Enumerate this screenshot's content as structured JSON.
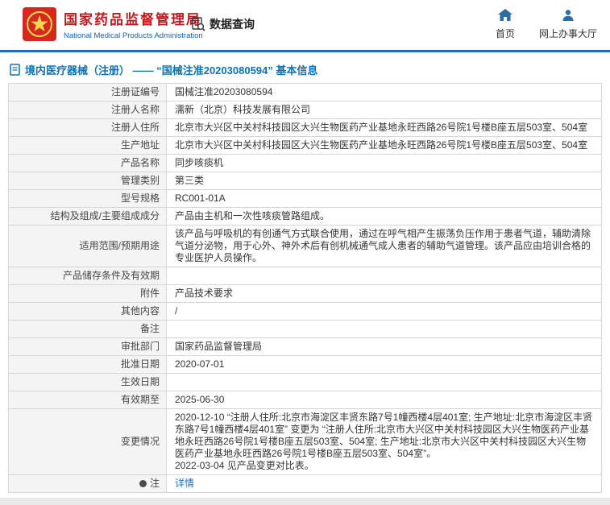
{
  "header": {
    "org_name_cn": "国家药品监督管理局",
    "org_name_en": "National Medical Products Administration",
    "data_query_label": "数据查询",
    "nav": [
      {
        "label": "首页",
        "icon": "home-icon"
      },
      {
        "label": "网上办事大厅",
        "icon": "person-icon"
      }
    ]
  },
  "page": {
    "title": "境内医疗器械（注册） —— “国械注准20203080594” 基本信息"
  },
  "colors": {
    "brand_red": "#c01920",
    "brand_blue": "#1b62a7",
    "header_line_blue": "#1e6cb5",
    "title_blue": "#0c72b8",
    "link_blue": "#1a73c0",
    "label_cell_bg": "#f4f4f4",
    "border": "#d6d6d6"
  },
  "icons": {
    "emblem": "national-emblem-icon",
    "data_query": "document-magnifier-icon",
    "home": "home-icon",
    "service_hall": "person-icon",
    "title": "document-icon",
    "note": "note-dot-icon"
  },
  "table": {
    "rows": [
      {
        "label": "注册证编号",
        "value": "国械注准20203080594"
      },
      {
        "label": "注册人名称",
        "value": "濡新（北京）科技发展有限公司"
      },
      {
        "label": "注册人住所",
        "value": "北京市大兴区中关村科技园区大兴生物医药产业基地永旺西路26号院1号楼B座五层503室、504室"
      },
      {
        "label": "生产地址",
        "value": "北京市大兴区中关村科技园区大兴生物医药产业基地永旺西路26号院1号楼B座五层503室、504室"
      },
      {
        "label": "产品名称",
        "value": "同步咳痰机"
      },
      {
        "label": "管理类别",
        "value": "第三类"
      },
      {
        "label": "型号规格",
        "value": "RC001-01A"
      },
      {
        "label": "结构及组成/主要组成成分",
        "value": "产品由主机和一次性咳痰管路组成。"
      },
      {
        "label": "适用范围/预期用途",
        "value": "该产品与呼吸机的有创通气方式联合使用，通过在呼气相产生振荡负压作用于患者气道，辅助清除气道分泌物，用于心外、神外术后有创机械通气成人患者的辅助气道管理。该产品应由培训合格的专业医护人员操作。"
      },
      {
        "label": "产品储存条件及有效期",
        "value": ""
      },
      {
        "label": "附件",
        "value": "产品技术要求"
      },
      {
        "label": "其他内容",
        "value": "/"
      },
      {
        "label": "备注",
        "value": ""
      },
      {
        "label": "审批部门",
        "value": "国家药品监督管理局"
      },
      {
        "label": "批准日期",
        "value": "2020-07-01"
      },
      {
        "label": "生效日期",
        "value": ""
      },
      {
        "label": "有效期至",
        "value": "2025-06-30"
      },
      {
        "label": "变更情况",
        "value": "2020-12-10 “注册人住所:北京市海淀区丰贤东路7号1幢西楼4层401室; 生产地址:北京市海淀区丰贤东路7号1幢西楼4层401室” 变更为 “注册人住所:北京市大兴区中关村科技园区大兴生物医药产业基地永旺西路26号院1号楼B座五层503室、504室; 生产地址:北京市大兴区中关村科技园区大兴生物医药产业基地永旺西路26号院1号楼B座五层503室、504室”。\n2022-03-04 见产品变更对比表。"
      },
      {
        "label": "注",
        "value": "详情"
      }
    ]
  }
}
